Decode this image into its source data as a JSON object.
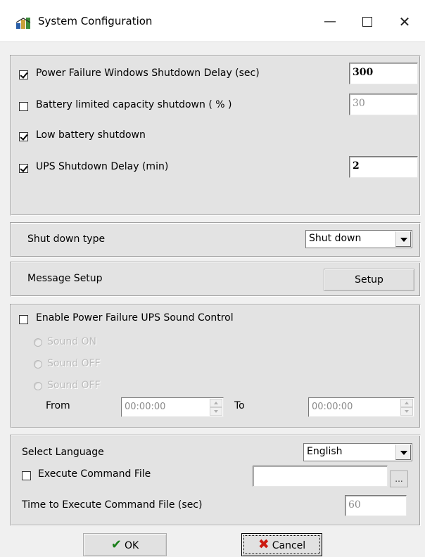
{
  "window": {
    "title": "System Configuration",
    "minimize": "—",
    "close": "✕"
  },
  "shutdown": {
    "power_failure": {
      "label": "Power Failure Windows Shutdown Delay (sec)",
      "checked": true,
      "value": "300"
    },
    "battery_limited": {
      "label": "Battery limited  capacity shutdown ( % )",
      "checked": false,
      "value": "30"
    },
    "low_battery": {
      "label": "Low battery shutdown",
      "checked": true
    },
    "ups_delay": {
      "label": "UPS Shutdown Delay (min)",
      "checked": true,
      "value": "2"
    }
  },
  "shutdown_type": {
    "label": "Shut down type",
    "selected": "Shut down"
  },
  "message_setup": {
    "label": "Message Setup",
    "button": "Setup"
  },
  "sound": {
    "enable_label": "Enable Power Failure UPS Sound Control",
    "enabled": false,
    "options": [
      "Sound ON",
      "Sound OFF",
      "Sound OFF"
    ],
    "from_label": "From",
    "from_value": "00:00:00",
    "to_label": "To",
    "to_value": "00:00:00"
  },
  "language": {
    "label": "Select Language",
    "selected": "English"
  },
  "command_file": {
    "label": "Execute Command File",
    "checked": false,
    "browse": "...",
    "time_label": "Time to Execute Command File (sec)",
    "time_value": "60"
  },
  "footer": {
    "ok": "OK",
    "cancel": "Cancel"
  },
  "colors": {
    "ok_check": "#1a7f1a",
    "cancel_x": "#cc1a10",
    "panel": "#e3e3e3"
  }
}
